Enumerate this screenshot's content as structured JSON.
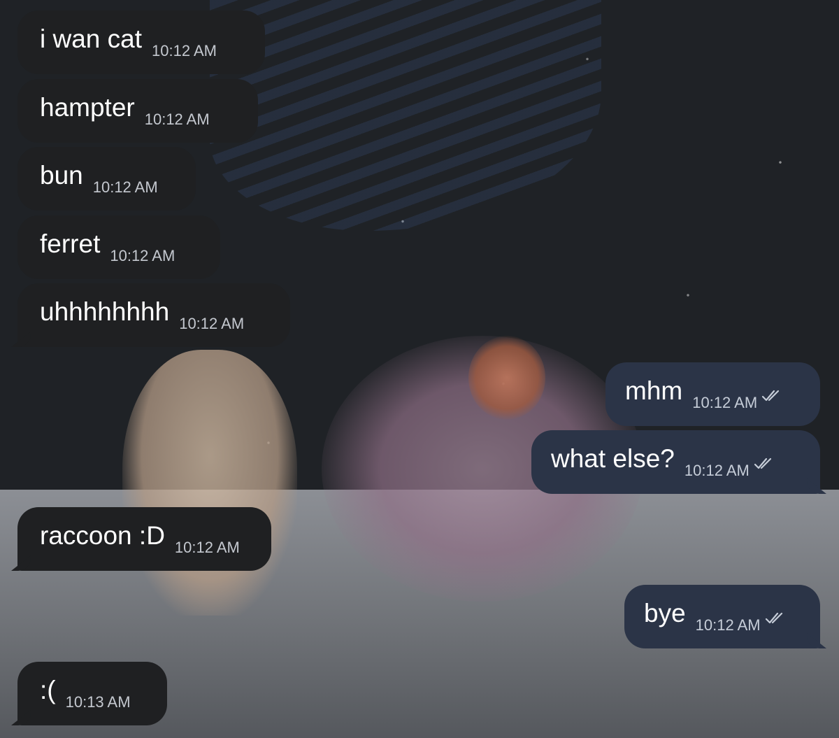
{
  "messages": [
    {
      "text": "i wan cat",
      "time": "10:12 AM",
      "direction": "incoming"
    },
    {
      "text": "hampter",
      "time": "10:12 AM",
      "direction": "incoming"
    },
    {
      "text": "bun",
      "time": "10:12 AM",
      "direction": "incoming"
    },
    {
      "text": "ferret",
      "time": "10:12 AM",
      "direction": "incoming"
    },
    {
      "text": "uhhhhhhhh",
      "time": "10:12 AM",
      "direction": "incoming"
    },
    {
      "text": "mhm",
      "time": "10:12 AM",
      "direction": "outgoing",
      "status": "read"
    },
    {
      "text": "what else?",
      "time": "10:12 AM",
      "direction": "outgoing",
      "status": "read"
    },
    {
      "text": "raccoon :D",
      "time": "10:12 AM",
      "direction": "incoming"
    },
    {
      "text": "bye",
      "time": "10:12 AM",
      "direction": "outgoing",
      "status": "read"
    },
    {
      "text": ":(",
      "time": "10:13 AM",
      "direction": "incoming"
    }
  ],
  "colors": {
    "incoming_bubble": "#1f2022",
    "outgoing_bubble": "#2b3447",
    "text": "#ffffff",
    "timestamp": "#c4c8cf"
  },
  "icons": {
    "read_receipt": "double-check-icon"
  }
}
